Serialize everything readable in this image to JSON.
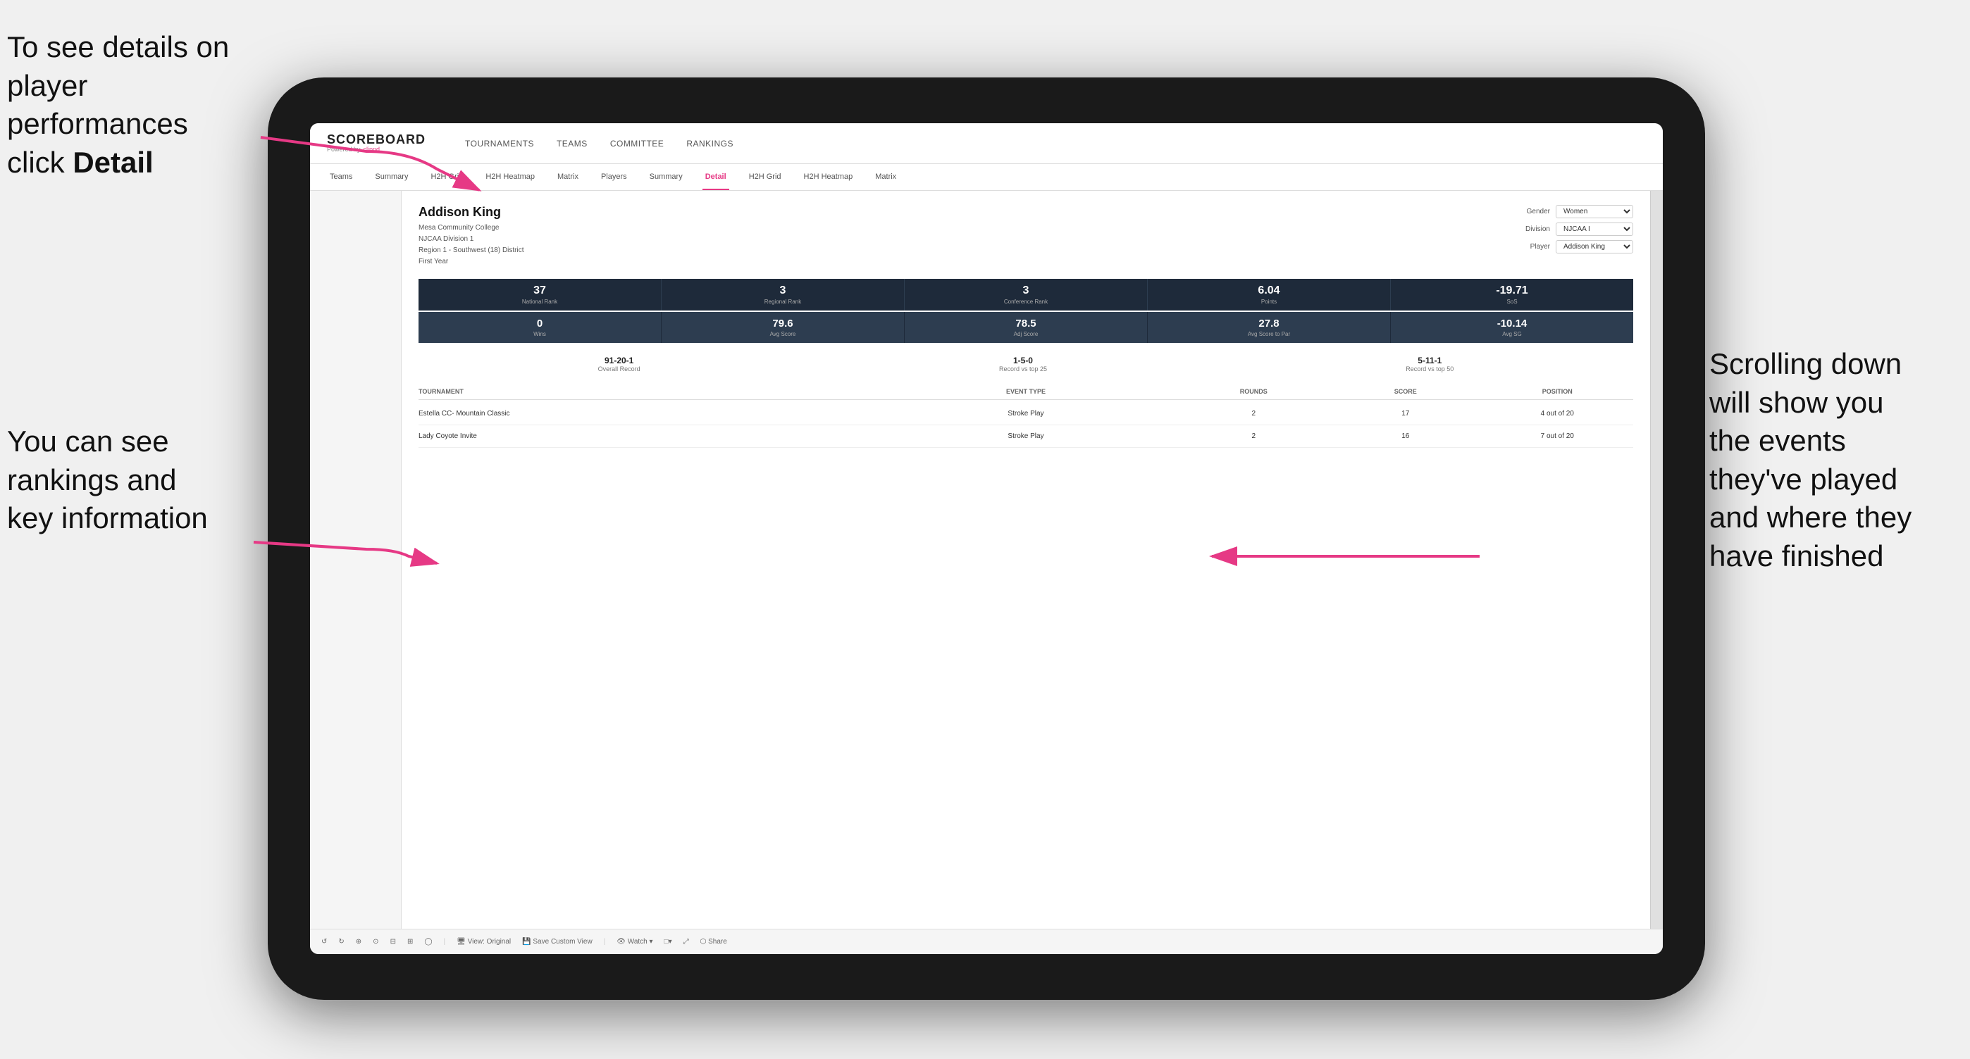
{
  "annotations": {
    "top_left": "To see details on player performances click ",
    "top_left_bold": "Detail",
    "bottom_left_line1": "You can see",
    "bottom_left_line2": "rankings and",
    "bottom_left_line3": "key information",
    "right_line1": "Scrolling down",
    "right_line2": "will show you",
    "right_line3": "the events",
    "right_line4": "they've played",
    "right_line5": "and where they",
    "right_line6": "have finished"
  },
  "header": {
    "logo": "SCOREBOARD",
    "logo_powered": "Powered by",
    "logo_brand": "clippd",
    "nav": [
      "TOURNAMENTS",
      "TEAMS",
      "COMMITTEE",
      "RANKINGS"
    ]
  },
  "sub_nav": {
    "items": [
      "Teams",
      "Summary",
      "H2H Grid",
      "H2H Heatmap",
      "Matrix",
      "Players",
      "Summary",
      "Detail",
      "H2H Grid",
      "H2H Heatmap",
      "Matrix"
    ],
    "active": "Detail"
  },
  "player": {
    "name": "Addison King",
    "school": "Mesa Community College",
    "division": "NJCAA Division 1",
    "region": "Region 1 - Southwest (18) District",
    "year": "First Year"
  },
  "filters": {
    "gender_label": "Gender",
    "gender_value": "Women",
    "division_label": "Division",
    "division_value": "NJCAA I",
    "player_label": "Player",
    "player_value": "Addison King"
  },
  "stats_row1": [
    {
      "value": "37",
      "label": "National Rank"
    },
    {
      "value": "3",
      "label": "Regional Rank"
    },
    {
      "value": "3",
      "label": "Conference Rank"
    },
    {
      "value": "6.04",
      "label": "Points"
    },
    {
      "value": "-19.71",
      "label": "SoS"
    }
  ],
  "stats_row2": [
    {
      "value": "0",
      "label": "Wins"
    },
    {
      "value": "79.6",
      "label": "Avg Score"
    },
    {
      "value": "78.5",
      "label": "Adj Score"
    },
    {
      "value": "27.8",
      "label": "Avg Score to Par"
    },
    {
      "value": "-10.14",
      "label": "Avg SG"
    }
  ],
  "records": [
    {
      "value": "91-20-1",
      "label": "Overall Record"
    },
    {
      "value": "1-5-0",
      "label": "Record vs top 25"
    },
    {
      "value": "5-11-1",
      "label": "Record vs top 50"
    }
  ],
  "table": {
    "headers": [
      "Tournament",
      "Event Type",
      "Rounds",
      "Score",
      "Position"
    ],
    "rows": [
      {
        "tournament": "Estella CC- Mountain Classic",
        "event_type": "Stroke Play",
        "rounds": "2",
        "score": "17",
        "position": "4 out of 20"
      },
      {
        "tournament": "Lady Coyote Invite",
        "event_type": "Stroke Play",
        "rounds": "2",
        "score": "16",
        "position": "7 out of 20"
      }
    ]
  },
  "toolbar": {
    "buttons": [
      "↺",
      "↻",
      "⊕",
      "⊙",
      "⊟",
      "⊞",
      "◯",
      "View: Original",
      "Save Custom View",
      "Watch ▾",
      "□▾",
      "⤢",
      "Share"
    ]
  }
}
